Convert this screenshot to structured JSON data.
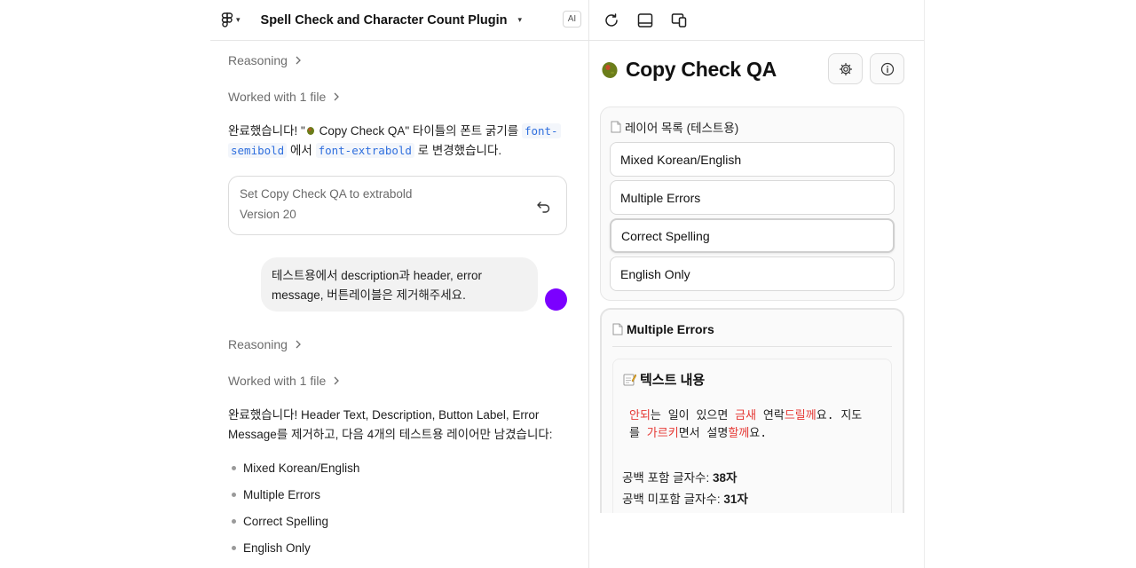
{
  "left": {
    "project_title": "Spell Check and Character Count Plugin",
    "ai_badge": "AI",
    "reasoning_1": "Reasoning",
    "worked_1": "Worked with 1 file",
    "msg1_part1": "완료했습니다! \"",
    "msg1_part2": " Copy Check QA\" 타이틀의 폰트 굵기를 ",
    "msg1_code1a": "font-",
    "msg1_code1b": "semibold",
    "msg1_part3": " 에서 ",
    "msg1_code2": "font-extrabold",
    "msg1_part4": " 로 변경했습니다.",
    "version_card": {
      "title": "Set Copy Check QA to extrabold",
      "version": "Version 20"
    },
    "user_msg_line1": "테스트용에서 description과 header, error",
    "user_msg_line2": "message, 버튼레이블은 제거해주세요.",
    "reasoning_2": "Reasoning",
    "worked_2": "Worked with 1 file",
    "msg2_line1": "완료했습니다! Header Text, Description, Button Label, Error",
    "msg2_line2": "Message를 제거하고, 다음 4개의 테스트용 레이어만 남겼습니다:",
    "bullets": [
      "Mixed Korean/English",
      "Multiple Errors",
      "Correct Spelling",
      "English Only"
    ],
    "colors": {
      "avatar": "#7b00ff",
      "code": "#2f6fde"
    }
  },
  "right": {
    "plugin_title": "Copy Check QA",
    "layers_heading": "레이어 목록 (테스트용)",
    "layers": [
      "Mixed Korean/English",
      "Multiple Errors",
      "Correct Spelling",
      "English Only"
    ],
    "detail_heading": "Multiple Errors",
    "text_heading": "텍스트 내용",
    "content": {
      "l1_e1": "안되",
      "l1_t1": "는 일이 있으면 ",
      "l1_e2": "금새",
      "l1_t2": " 연락",
      "l1_e3": "드릴께",
      "l1_t3": "요. 지도",
      "l2_t0": "를 ",
      "l2_e1": "가르키",
      "l2_t1": "면서 설명",
      "l2_e2": "할께",
      "l2_t2": "요."
    },
    "count_with_space_label": "공백 포함 글자수: ",
    "count_with_space_value": "38자",
    "count_without_space_label": "공백 미포함 글자수: ",
    "count_without_space_value": "31자",
    "colors": {
      "error": "#e53935"
    }
  },
  "icons": [
    "figma-logo-icon",
    "chevron-down-icon",
    "chevron-right-icon",
    "undo-icon",
    "refresh-icon",
    "panel-layout-icon",
    "device-preview-icon",
    "olive-icon",
    "gear-icon",
    "info-icon",
    "document-icon",
    "memo-icon"
  ]
}
